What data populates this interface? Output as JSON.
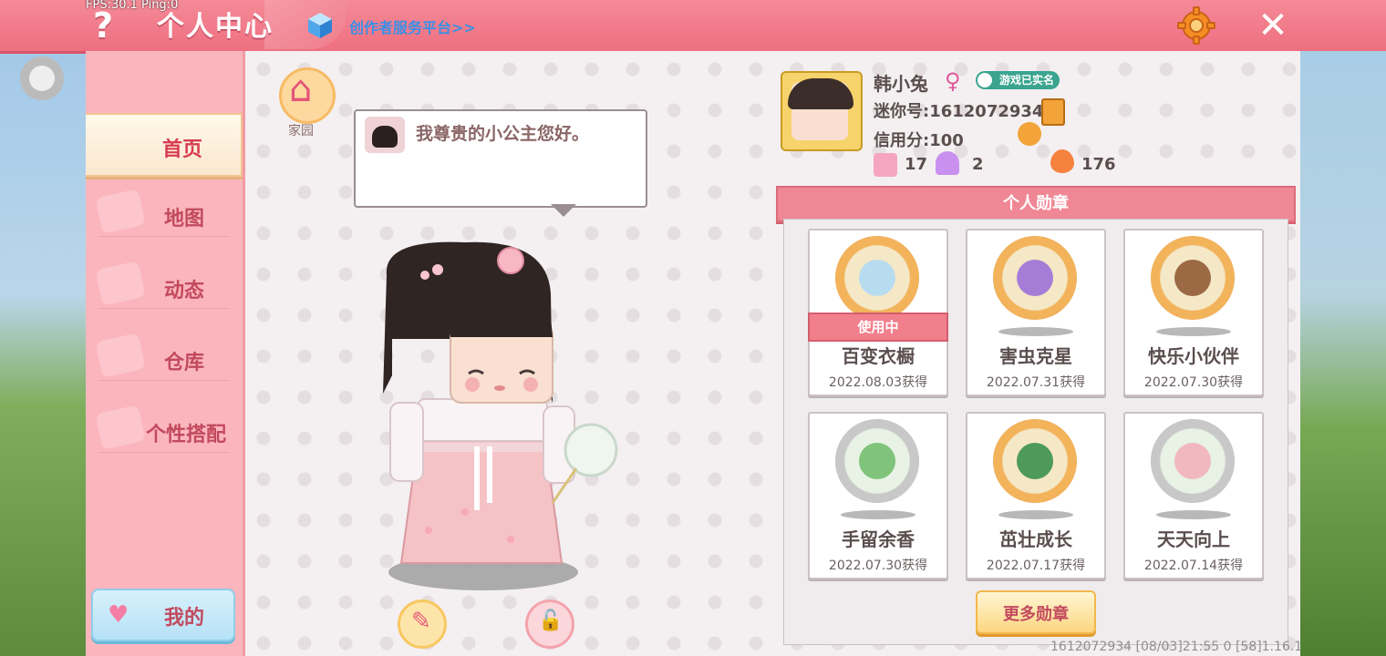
{
  "debug": {
    "fps_text": "FPS:30.1 Ping:0"
  },
  "header": {
    "title": "个人中心",
    "creator_link": "创作者服务平台>>",
    "help_icon": "question-icon",
    "settings_icon": "gear-icon",
    "close_icon": "close-icon"
  },
  "sidebar": {
    "items": [
      {
        "label": "首页",
        "active": true
      },
      {
        "label": "地图",
        "active": false
      },
      {
        "label": "动态",
        "active": false
      },
      {
        "label": "仓库",
        "active": false
      },
      {
        "label": "个性搭配",
        "active": false
      }
    ],
    "mine_label": "我的"
  },
  "home": {
    "label": "家园"
  },
  "speech": {
    "text": "我尊贵的小公主您好。"
  },
  "profile": {
    "name": "韩小兔",
    "gender": "♀",
    "verified_badge": "游戏已实名",
    "mini_id": "迷你号:1612072934",
    "credit": "信用分:100",
    "stats": [
      {
        "icon": "star-badge-icon",
        "value": "17"
      },
      {
        "icon": "cheer-icon",
        "value": "2"
      },
      {
        "icon": "fire-icon",
        "value": "176"
      }
    ]
  },
  "medals": {
    "header": "个人勋章",
    "in_use_label": "使用中",
    "items": [
      {
        "name": "百变衣橱",
        "date": "2022.08.03获得",
        "type": "gold",
        "in_use": true
      },
      {
        "name": "害虫克星",
        "date": "2022.07.31获得",
        "type": "gold",
        "in_use": false
      },
      {
        "name": "快乐小伙伴",
        "date": "2022.07.30获得",
        "type": "gold",
        "in_use": false
      },
      {
        "name": "手留余香",
        "date": "2022.07.30获得",
        "type": "silver",
        "in_use": false
      },
      {
        "name": "茁壮成长",
        "date": "2022.07.17获得",
        "type": "gold",
        "in_use": false
      },
      {
        "name": "天天向上",
        "date": "2022.07.14获得",
        "type": "silver",
        "in_use": false
      }
    ],
    "more_label": "更多勋章"
  },
  "footer": {
    "build_info": "1612072934    [08/03]21:55 0   [58]1.16.1"
  },
  "colors": {
    "accent": "#ee6f80",
    "sidebar": "#fbb6bd",
    "text_pink": "#c24a5f",
    "link_blue": "#3b8fe6"
  }
}
